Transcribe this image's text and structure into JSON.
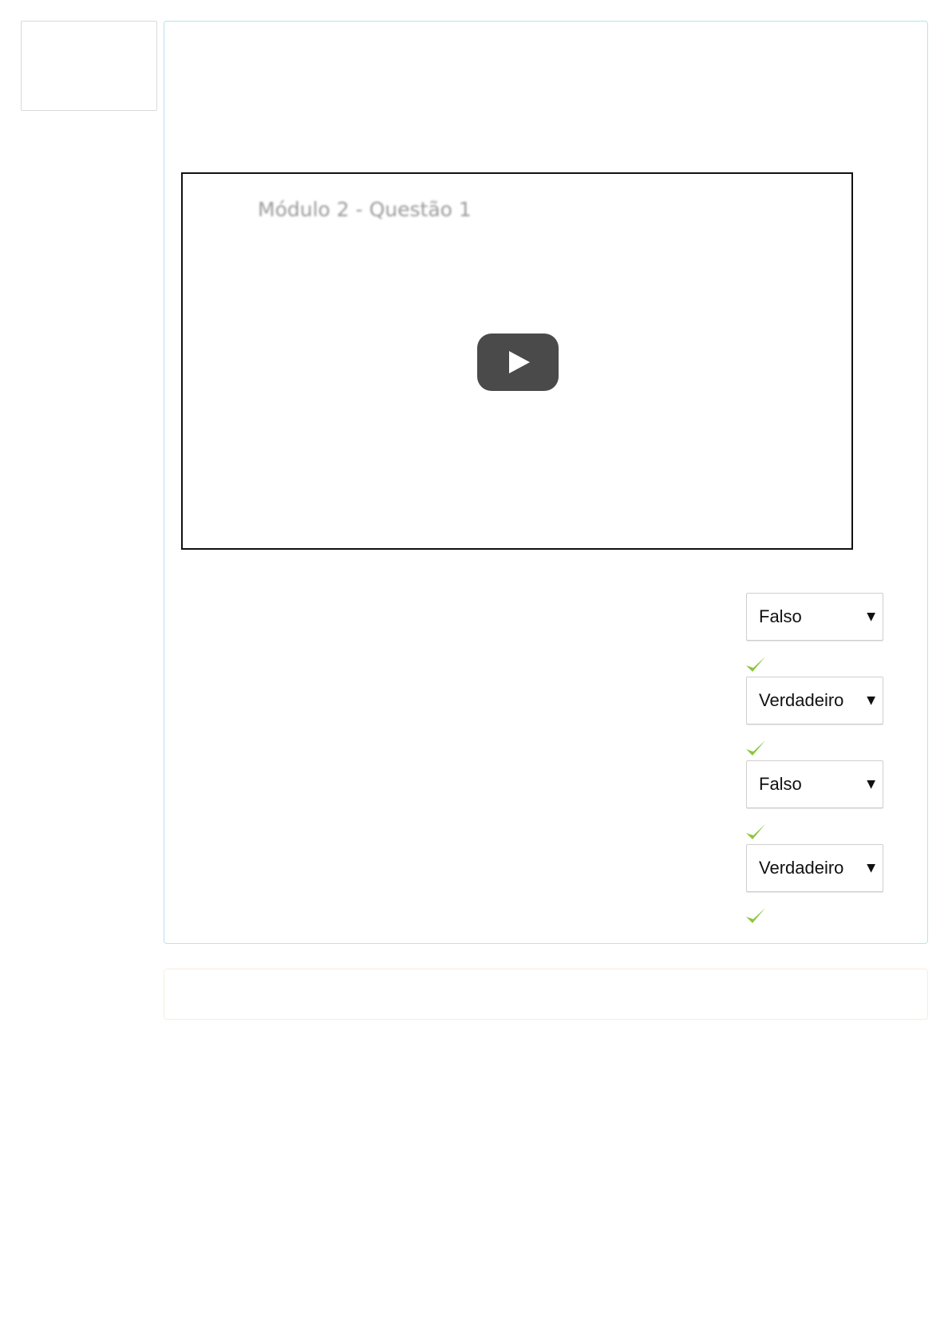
{
  "video": {
    "title": "Módulo 2 - Questão 1",
    "play_icon": "play-icon"
  },
  "answers": [
    {
      "selected": "Falso",
      "status_icon": "checkmark-icon",
      "correct": true
    },
    {
      "selected": "Verdadeiro",
      "status_icon": "checkmark-icon",
      "correct": true
    },
    {
      "selected": "Falso",
      "status_icon": "checkmark-icon",
      "correct": true
    },
    {
      "selected": "Verdadeiro",
      "status_icon": "checkmark-icon",
      "correct": true
    }
  ],
  "colors": {
    "panel_border": "#b8e3ec",
    "feedback_border": "#f6eedd",
    "check": "#8cc63f",
    "play_button": "#4a4a4a"
  }
}
